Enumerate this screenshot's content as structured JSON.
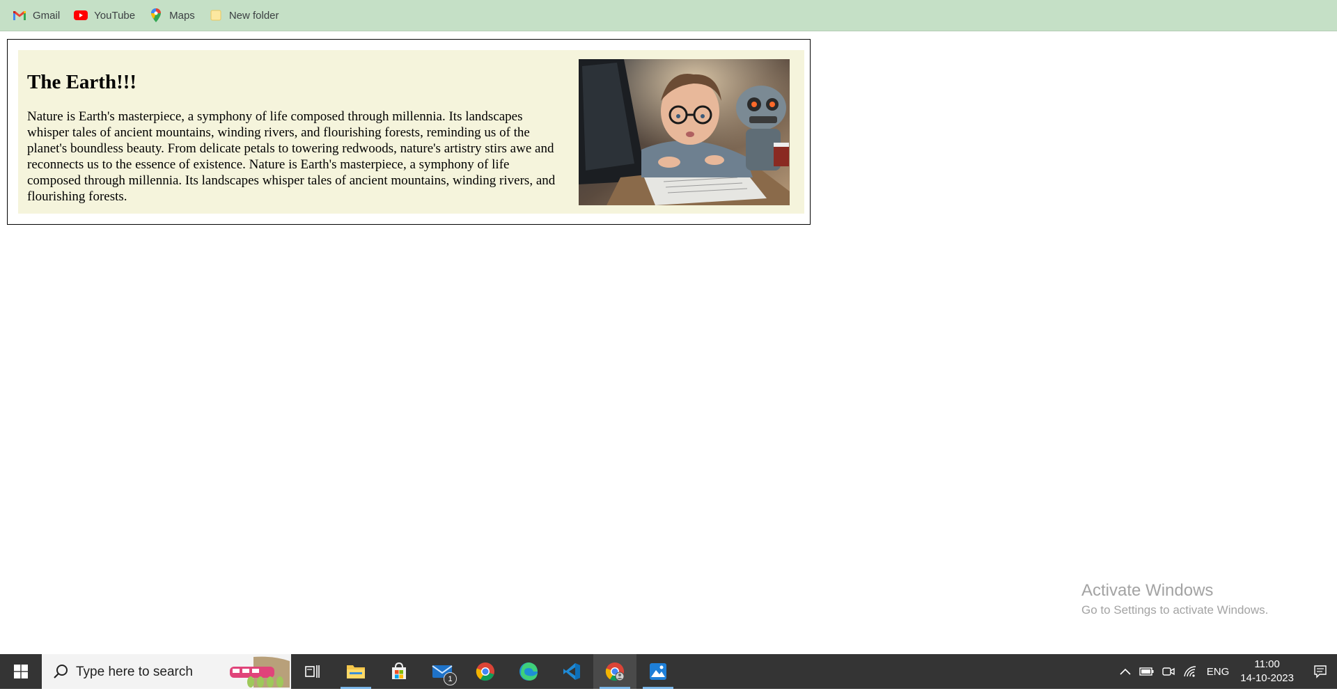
{
  "bookmarks": [
    {
      "label": "Gmail",
      "icon": "gmail-icon"
    },
    {
      "label": "YouTube",
      "icon": "youtube-icon"
    },
    {
      "label": "Maps",
      "icon": "maps-icon"
    },
    {
      "label": "New folder",
      "icon": "folder-icon"
    }
  ],
  "card": {
    "title": "The Earth!!!",
    "text": "Nature is Earth's masterpiece, a symphony of life composed through millennia. Its landscapes whisper tales of ancient mountains, winding rivers, and flourishing forests, reminding us of the planet's boundless beauty. From delicate petals to towering redwoods, nature's artistry stirs awe and reconnects us to the essence of existence. Nature is Earth's masterpiece, a symphony of life composed through millennia. Its landscapes whisper tales of ancient mountains, winding rivers, and flourishing forests.",
    "background_color": "#f5f4dc",
    "border_color": "#000000"
  },
  "watermark": {
    "title": "Activate Windows",
    "subtitle": "Go to Settings to activate Windows."
  },
  "taskbar": {
    "search_placeholder": "Type here to search",
    "apps": [
      {
        "name": "task-view",
        "icon": "task-view-icon"
      },
      {
        "name": "file-explorer",
        "icon": "folder-icon"
      },
      {
        "name": "microsoft-store",
        "icon": "store-icon"
      },
      {
        "name": "mail",
        "icon": "mail-icon",
        "badge": "1"
      },
      {
        "name": "chrome",
        "icon": "chrome-icon"
      },
      {
        "name": "edge",
        "icon": "edge-icon"
      },
      {
        "name": "vscode",
        "icon": "vscode-icon"
      },
      {
        "name": "chrome-profile",
        "icon": "chrome-icon"
      },
      {
        "name": "photos",
        "icon": "photos-icon"
      }
    ],
    "language": "ENG",
    "time": "11:00",
    "date": "14-10-2023"
  },
  "colors": {
    "bookmarks_bar": "#c5e0c6",
    "taskbar": "#343434",
    "active_indicator": "#7ab6e8"
  }
}
